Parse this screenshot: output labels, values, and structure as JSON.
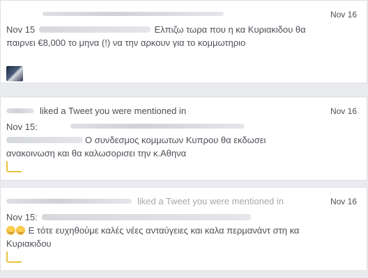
{
  "notifications": [
    {
      "date": "Nov 16",
      "header_fragment": "",
      "prefix": "Nov 15",
      "text": "Ελπιζω τωρα που η κα Κυριακιδου θα παιρνει €8,000 το μηνα (!) να την αρκουν για το κομμωτηριο"
    },
    {
      "date": "Nov 16",
      "header_fragment": "liked a Tweet you were mentioned in",
      "prefix": "Nov 15:",
      "text": "Ο συνδεσμος κομμωτων Κυπρου θα εκδωσει ανακοινωση και θα καλωσορισει την κ.Αθηνα"
    },
    {
      "date": "Nov 16",
      "header_fragment": "liked a Tweet you were mentioned in",
      "prefix": "Nov 15:",
      "text": "Ε τότε ευχηθούμε καλές νέες ανταύγειες και καλα περμανάντ στη κα Κυριακιδου"
    }
  ]
}
